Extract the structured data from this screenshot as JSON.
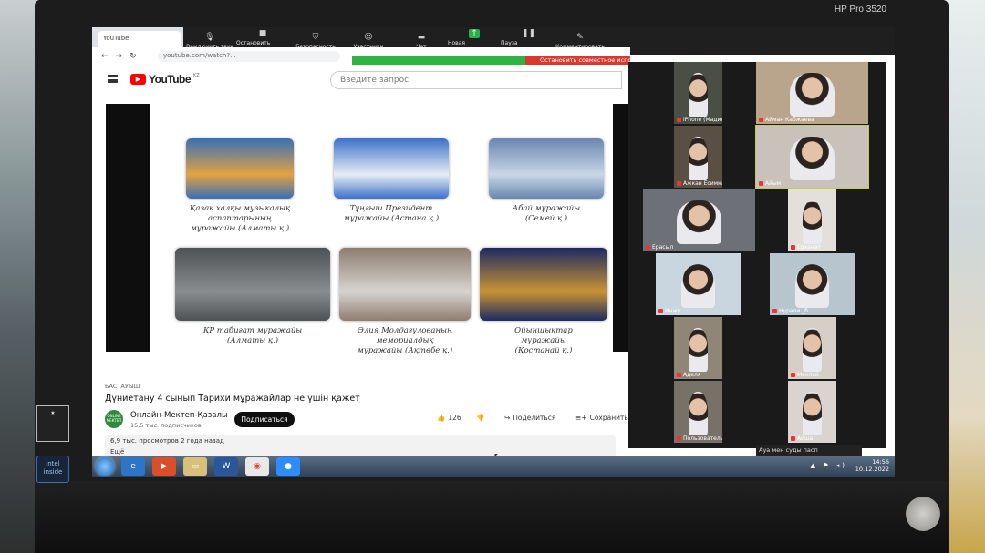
{
  "monitor": {
    "brand": "HP Pro 3520",
    "intel_label": "intel inside"
  },
  "browser_tab": {
    "title": "YouTube"
  },
  "zoom_toolbar": {
    "items": [
      {
        "label": "Выключить звук",
        "icon": "microphone-icon"
      },
      {
        "label": "Остановить видео",
        "icon": "camera-icon"
      },
      {
        "label": "Безопасность",
        "icon": "shield-icon"
      },
      {
        "label": "Участники",
        "icon": "participants-icon"
      },
      {
        "label": "Чат",
        "icon": "chat-icon"
      },
      {
        "label": "Новая демонстрация",
        "icon": "share-icon"
      },
      {
        "label": "Пауза демонстрации",
        "icon": "pause-icon"
      },
      {
        "label": "Комментировать",
        "icon": "pen-icon"
      }
    ],
    "stop_share": "Остановить совместное исполь"
  },
  "youtube": {
    "url": "youtube.com/watch?...",
    "search_placeholder": "Введите запрос",
    "logo": "YouTube",
    "logo_cc": "KZ"
  },
  "video_tiles": [
    {
      "caption": "Қазақ халқы музыкалық\nаспаптарының\nмұражайы (Алматы қ.)",
      "colors": [
        "#e2a243",
        "#3a6fb5"
      ]
    },
    {
      "caption": "Тұңғыш Президент\nмұражайы (Астана қ.)",
      "colors": [
        "#e6edf5",
        "#3d72c9"
      ]
    },
    {
      "caption": "Абай мұражайы\n(Семей қ.)",
      "colors": [
        "#c9d7e6",
        "#6a86b0"
      ]
    },
    {
      "caption": "ҚР табиғат мұражайы\n(Алматы қ.)",
      "colors": [
        "#8a8d8f",
        "#4d5254"
      ]
    },
    {
      "caption": "Әлия Молдағұлованың\nмемориалдық\nмұражайы (Ақтөбе қ.)",
      "colors": [
        "#d7d3cf",
        "#8e7d6f"
      ]
    },
    {
      "caption": "Ойыншықтар\nмұражайы\n(Қостанай қ.)",
      "colors": [
        "#c89434",
        "#1d2a62"
      ]
    }
  ],
  "video_info": {
    "tag": "БАСТАУЫШ",
    "title": "Дүниетану 4 сынып Тарихи мұражайлар не үшін қажет",
    "channel": "Онлайн-Мектеп-Қазалы",
    "subscribers": "15,5 тыс. подписчиков",
    "subscribe": "Подписаться",
    "likes": "126",
    "share": "Поделиться",
    "save": "Сохранить",
    "views": "6,9 тыс. просмотров  2 года назад",
    "more": "Ещё"
  },
  "participants": [
    {
      "name": "iPhone (Мадина)"
    },
    {
      "name": "Айман Кабжаева"
    },
    {
      "name": "Ажкан Есимканова"
    },
    {
      "name": "Айым"
    },
    {
      "name": "Ерасыл"
    },
    {
      "name": "Ерханат"
    },
    {
      "name": "Инжу"
    },
    {
      "name": "Нурали _б"
    },
    {
      "name": "Аделя"
    },
    {
      "name": "Махлай"
    },
    {
      "name": "Пользователь Zoom"
    },
    {
      "name": "Айша"
    }
  ],
  "zoom_tip": "Ауа мен суды пасп",
  "taskbar": {
    "time": "14:56",
    "date": "10.12.2022"
  }
}
